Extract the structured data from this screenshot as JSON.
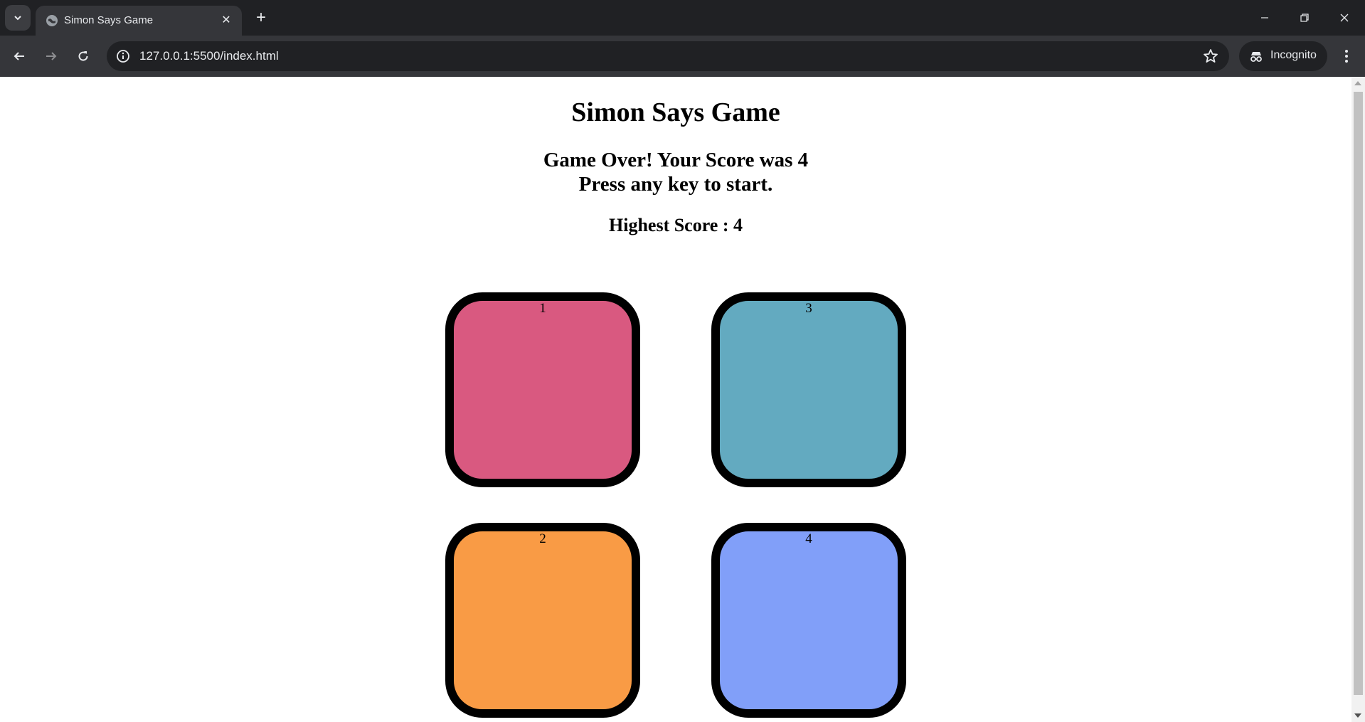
{
  "browser": {
    "tab_title": "Simon Says Game",
    "url": "127.0.0.1:5500/index.html",
    "incognito_label": "Incognito"
  },
  "page": {
    "title": "Simon Says Game",
    "status_line1": "Game Over! Your Score was 4",
    "status_line2": "Press any key to start.",
    "highest_score": "Highest Score : 4"
  },
  "buttons": [
    {
      "label": "1",
      "color": "#d95980"
    },
    {
      "label": "3",
      "color": "#63aac0"
    },
    {
      "label": "2",
      "color": "#f99b45"
    },
    {
      "label": "4",
      "color": "#819ff9"
    }
  ],
  "colors": {
    "chrome_dark": "#202124",
    "chrome_toolbar": "#35363a",
    "border": "#000000"
  }
}
